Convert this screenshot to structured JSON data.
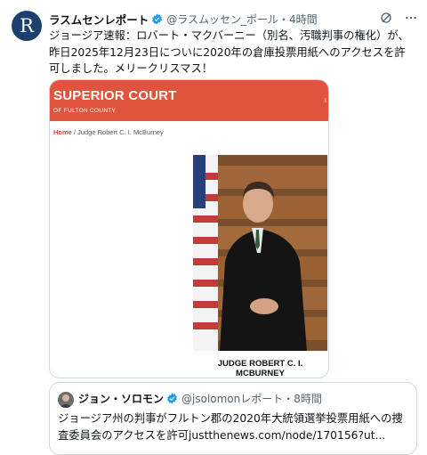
{
  "tweet": {
    "avatar_letter": "R",
    "author_name": "ラスムセンレポート",
    "handle_line": "@ラスムッセン_ポール・4時間",
    "text": "ジョージア速報：ロバート・マクバーニー（別名、汚職判事の権化）が、昨日2025年12月23日についに2020年の倉庫投票用紙へのアクセスを許可しました。メリークリスマス！",
    "icons": {
      "verified": "verified-badge-icon",
      "grok": "grok-icon",
      "more": "more-icon"
    }
  },
  "media": {
    "court_title": "SUPERIOR COURT",
    "court_subtitle": "OF FULTON COUNTY",
    "court_edge_glyph": "I",
    "breadcrumb_home": "Home",
    "breadcrumb_rest": " / Judge Robert C. I. McBurney",
    "caption": "JUDGE ROBERT C. I. MCBURNEY",
    "colors": {
      "banner": "#e0533c",
      "home_link": "#d94a34"
    }
  },
  "quote": {
    "author_name": "ジョン・ソロモン",
    "handle_line": "@jsolomonレポート・8時間",
    "text": "ジョージア州の判事がフルトン郡の2020年大統領選挙投票用紙への捜査委員会のアクセスを許可justthenews.com/node/170156?ut..."
  },
  "colors": {
    "verified": "#1d9bf0",
    "secondary_text": "#536471",
    "border": "#cfd9de"
  }
}
